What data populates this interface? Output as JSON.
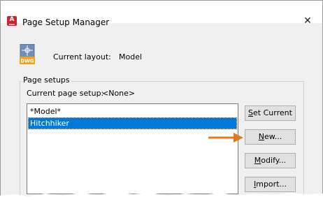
{
  "window": {
    "title": "Page Setup Manager",
    "close_glyph": "✕",
    "app_icon": {
      "letter": "A",
      "sub": "DWG"
    }
  },
  "layout": {
    "icon_text": "DWG",
    "label": "Current layout:",
    "value": "Model"
  },
  "page_setups": {
    "group_label": "Page setups",
    "current_label": "Current page setup:",
    "current_value": "<None>",
    "items": [
      {
        "label": "*Model*",
        "selected": false
      },
      {
        "label": "Hitchhiker",
        "selected": true
      }
    ]
  },
  "buttons": {
    "set_current": {
      "mnemonic": "S",
      "rest": "et Current"
    },
    "new": {
      "mnemonic": "N",
      "rest": "ew..."
    },
    "modify": {
      "mnemonic": "M",
      "rest": "odify..."
    },
    "import": {
      "mnemonic": "I",
      "rest": "mport..."
    }
  },
  "colors": {
    "accent": "#0078d7",
    "app_icon": "#d41f2c",
    "arrow": "#e07a22",
    "dwg_icon": "#f0a020"
  },
  "icons": {
    "app": "autocad-app-icon",
    "close": "close-icon",
    "dwg": "dwg-file-icon",
    "pointer": "arrow-pointer-icon"
  }
}
